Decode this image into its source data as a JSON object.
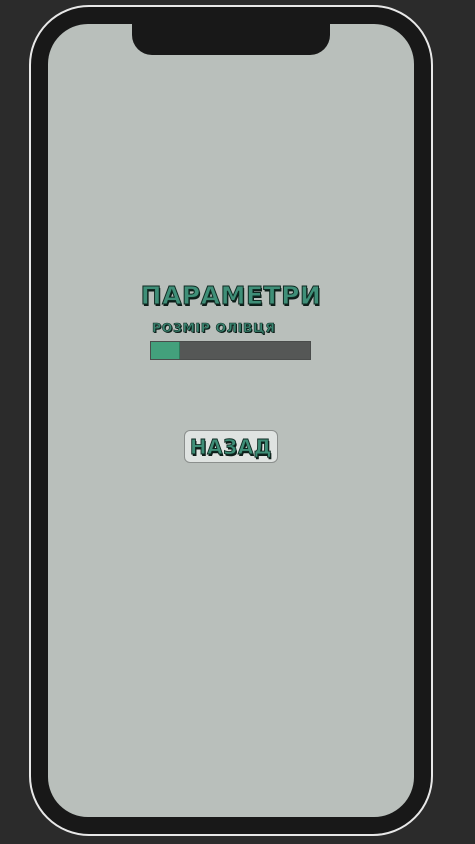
{
  "settings": {
    "title": "ПАРАМЕТРИ",
    "pencil_size_label": "РОЗМІР ОЛІВЦЯ",
    "pencil_size_fraction": 0.18
  },
  "actions": {
    "back_label": "НАЗАД"
  },
  "colors": {
    "background": "#2b2b2b",
    "frame": "#181818",
    "screen": "#b9bfbb",
    "accent": "#43a07c",
    "track": "#555756"
  }
}
